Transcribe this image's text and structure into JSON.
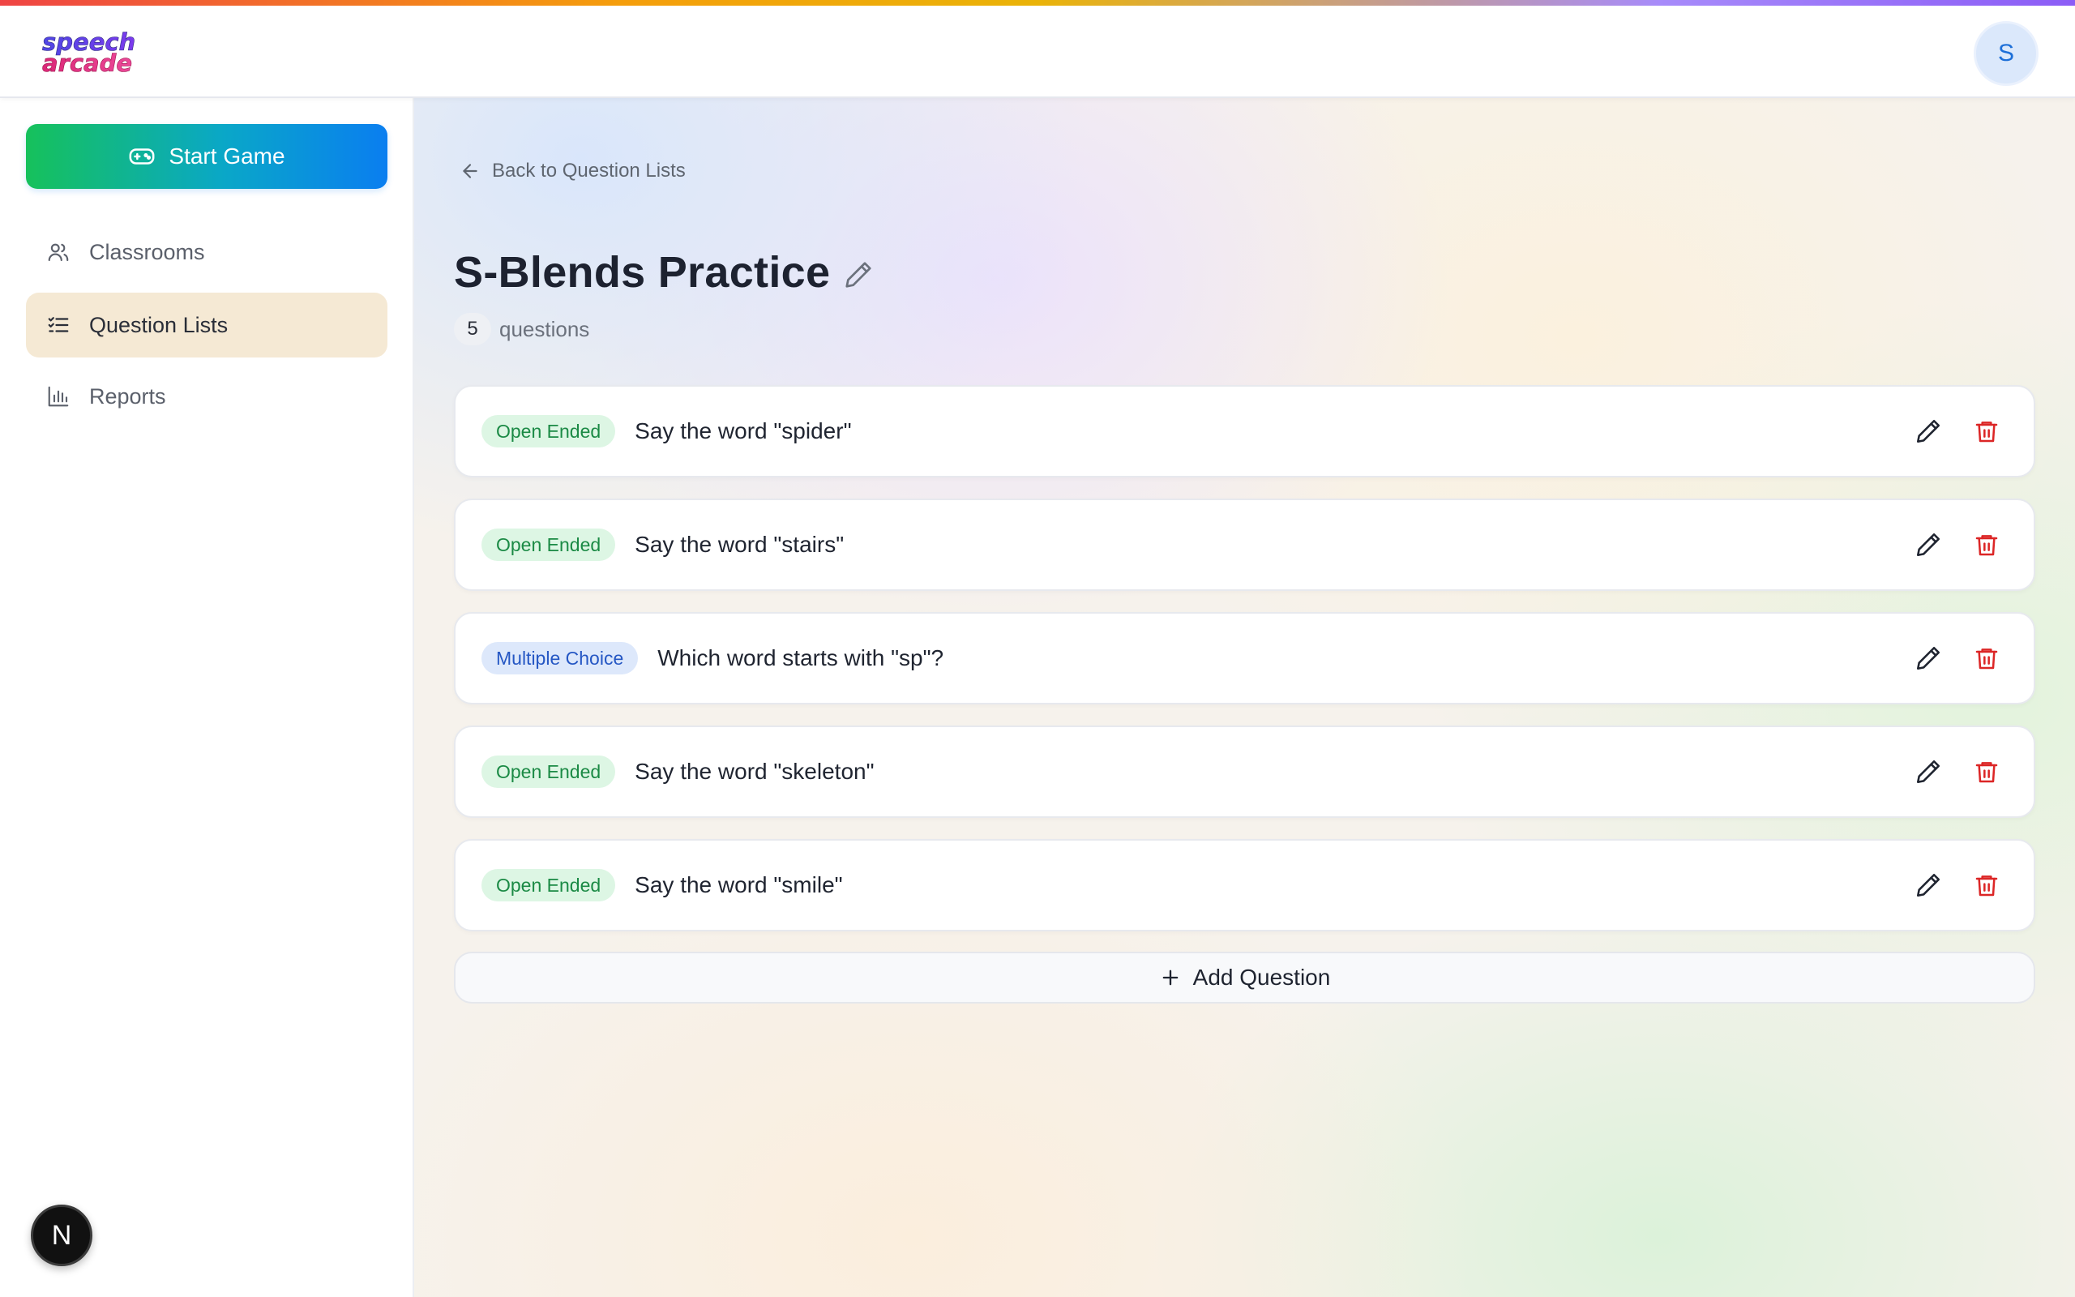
{
  "brand": {
    "logo_line1": "speech",
    "logo_line2": "arcade"
  },
  "user": {
    "avatar_initial": "S"
  },
  "sidebar": {
    "start_game_label": "Start Game",
    "items": [
      {
        "label": "Classrooms",
        "icon": "users-icon",
        "active": false
      },
      {
        "label": "Question Lists",
        "icon": "list-checks-icon",
        "active": true
      },
      {
        "label": "Reports",
        "icon": "bar-chart-icon",
        "active": false
      }
    ]
  },
  "nextjs_badge": "N",
  "main": {
    "back_label": "Back to Question Lists",
    "title": "S-Blends Practice",
    "question_count": "5",
    "question_count_label": "questions",
    "questions": [
      {
        "type": "Open Ended",
        "text": "Say the word \"spider\""
      },
      {
        "type": "Open Ended",
        "text": "Say the word \"stairs\""
      },
      {
        "type": "Multiple Choice",
        "text": "Which word starts with \"sp\"?"
      },
      {
        "type": "Open Ended",
        "text": "Say the word \"skeleton\""
      },
      {
        "type": "Open Ended",
        "text": "Say the word \"smile\""
      }
    ],
    "add_question_label": "Add Question"
  },
  "colors": {
    "open_ended_badge_bg": "#ddf6e4",
    "open_ended_badge_text": "#1b8a45",
    "multiple_choice_badge_bg": "#dde8fb",
    "multiple_choice_badge_text": "#2557c4",
    "delete_icon": "#dc2626",
    "active_nav_bg": "#f5e9d4"
  }
}
